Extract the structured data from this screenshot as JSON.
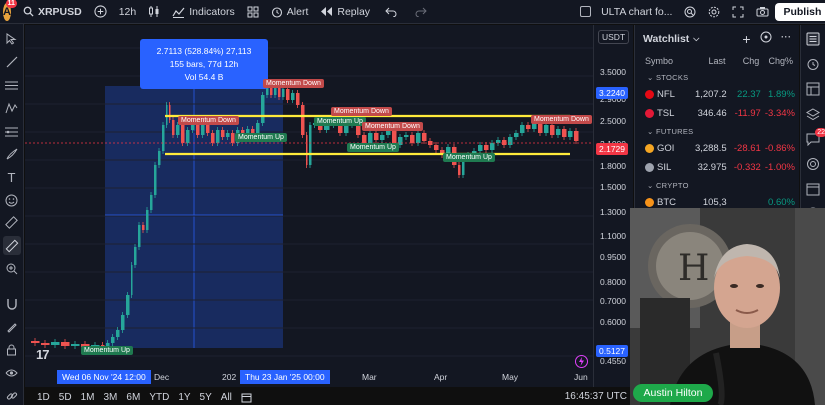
{
  "topbar": {
    "avatar_letter": "A",
    "avatar_badge": "11",
    "symbol": "XRPUSD",
    "interval": "12h",
    "indicators_label": "Indicators",
    "alert_label": "Alert",
    "replay_label": "Replay",
    "layout_name": "ULTA chart fo...",
    "publish_label": "Publish"
  },
  "chart": {
    "measure": {
      "line1": "2.7113 (528.84%) 27,113",
      "line2": "155 bars, 77d 12h",
      "line3": "Vol 54.4 B"
    },
    "currency": "USDT",
    "price_ticks": [
      "3.5000",
      "2.9000",
      "2.5000",
      "2.1000",
      "1.8000",
      "1.5000",
      "1.3000",
      "1.1000",
      "0.9500",
      "0.8000",
      "0.7000",
      "0.6000",
      "0.4550"
    ],
    "price_boxes": [
      {
        "value": "3.2240",
        "color": "#2962ff"
      },
      {
        "value": "2.1729",
        "color": "#f23645"
      },
      {
        "value": "0.5127",
        "color": "#2962ff"
      }
    ],
    "time_ticks": [
      "Dec",
      "202",
      "Mar",
      "Apr",
      "May",
      "Jun"
    ],
    "time_boxes": [
      "Wed 06 Nov '24   12:00",
      "Thu 23 Jan '25   00:00"
    ],
    "labels": [
      {
        "text": "Momentum Down",
        "kind": "down"
      },
      {
        "text": "Momentum Down",
        "kind": "down"
      },
      {
        "text": "Momentum Up",
        "kind": "up"
      },
      {
        "text": "Momentum Down",
        "kind": "down"
      },
      {
        "text": "Momentum Down",
        "kind": "down"
      },
      {
        "text": "Momentum Up",
        "kind": "up"
      },
      {
        "text": "Momentum Down",
        "kind": "down"
      },
      {
        "text": "Momentum Up",
        "kind": "up"
      },
      {
        "text": "Momentum Up",
        "kind": "up"
      },
      {
        "text": "Momentum Up",
        "kind": "up"
      },
      {
        "text": "Momentum Down",
        "kind": "down"
      }
    ],
    "colors": {
      "up": "#26a69a",
      "down": "#ef5350",
      "levels": "#ffeb3b",
      "measure": "#2962ff"
    }
  },
  "bottombar": {
    "ranges": [
      "1D",
      "5D",
      "1M",
      "3M",
      "6M",
      "YTD",
      "1Y",
      "5Y",
      "All"
    ],
    "clock": "16:45:37 UTC"
  },
  "watchlist": {
    "title": "Watchlist",
    "columns": {
      "symbol": "Symbo",
      "last": "Last",
      "chg": "Chg",
      "chgp": "Chg%"
    },
    "sections": [
      {
        "name": "STOCKS",
        "rows": [
          {
            "sym": "NFL",
            "last": "1,207.2",
            "chg": "22.37",
            "chgp": "1.89%",
            "dir": "pos",
            "color": "#e50914"
          },
          {
            "sym": "TSL",
            "last": "346.46",
            "chg": "-11.97",
            "chgp": "-3.34%",
            "dir": "neg",
            "color": "#e31937"
          }
        ]
      },
      {
        "name": "FUTURES",
        "rows": [
          {
            "sym": "GOI",
            "last": "3,288.5",
            "chg": "-28.61",
            "chgp": "-0.86%",
            "dir": "neg",
            "color": "#f5a623"
          },
          {
            "sym": "SIL",
            "last": "32.975",
            "chg": "-0.332",
            "chgp": "-1.00%",
            "dir": "neg",
            "color": "#9ea3ae"
          }
        ]
      },
      {
        "name": "CRYPTO",
        "rows": [
          {
            "sym": "BTC",
            "last": "105,3",
            "chg": "",
            "chgp": "0.60%",
            "dir": "pos",
            "color": "#f7931a"
          },
          {
            "sym": "E",
            "last": "",
            "chg": "",
            "chgp": "",
            "dir": "pos",
            "color": "#627eea"
          }
        ]
      }
    ]
  },
  "rightbar": {
    "alerts_badge": "22",
    "notifications_badge": "99+"
  },
  "webcam": {
    "name": "Austin Hilton"
  }
}
